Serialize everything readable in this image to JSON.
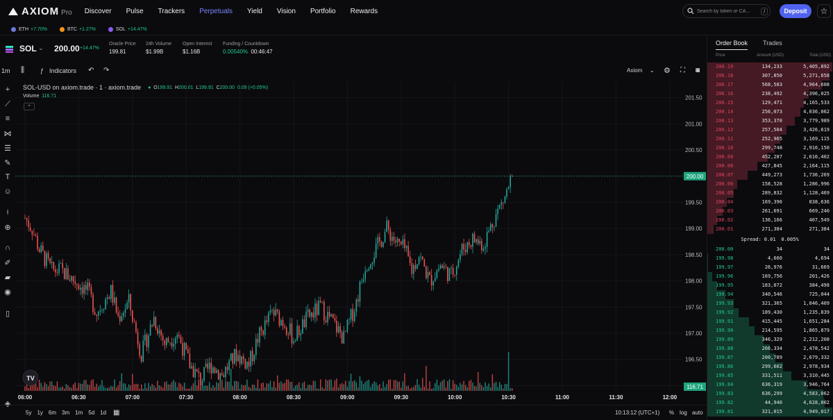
{
  "header": {
    "logo_text": "AXIOM",
    "logo_sub": "Pro",
    "nav": [
      "Discover",
      "Pulse",
      "Trackers",
      "Perpetuals",
      "Yield",
      "Vision",
      "Portfolio",
      "Rewards"
    ],
    "active_nav": "Perpetuals",
    "search_placeholder": "Search by token or CA...",
    "search_shortcut": "/",
    "deposit_label": "Deposit",
    "accent": "#5063f0"
  },
  "ticker": [
    {
      "symbol": "ETH",
      "change": "+7.70%",
      "color": "#6b7bd9"
    },
    {
      "symbol": "BTC",
      "change": "+1.27%",
      "color": "#f7931a"
    },
    {
      "symbol": "SOL",
      "change": "+14.47%",
      "color": "#8c5cf0"
    }
  ],
  "market": {
    "pair": "SOL",
    "price": "200.00",
    "change": "+14.47%",
    "stats": [
      {
        "label": "Oracle Price",
        "value": "199.81"
      },
      {
        "label": "24h Volume",
        "value": "$1.99B"
      },
      {
        "label": "Open Interest",
        "value": "$1.16B"
      },
      {
        "label": "Funding / Countdown",
        "value": "0.00540%",
        "value2": "00:46:47"
      }
    ]
  },
  "chart_toolbar": {
    "interval": "1m",
    "indicators_label": "Indicators",
    "source_label": "Axiom"
  },
  "chart_legend": {
    "title": "SOL-USD on axiom.trade · 1 · axiom.trade",
    "o_label": "O",
    "o": "199.91",
    "h_label": "H",
    "h": "200.01",
    "l_label": "L",
    "l": "199.91",
    "c_label": "C",
    "c": "200.00",
    "chg": "0.09 (+0.05%)",
    "volume_label": "Volume",
    "volume_value": "116.71"
  },
  "chart_data": {
    "type": "candlestick",
    "x_ticks": [
      "06:00",
      "06:30",
      "07:00",
      "07:30",
      "08:00",
      "08:30",
      "09:00",
      "09:30",
      "10:00",
      "10:30",
      "11:00",
      "11:30",
      "12:00"
    ],
    "y_ticks": [
      "201.50",
      "201.00",
      "200.50",
      "200.00",
      "199.50",
      "199.00",
      "198.50",
      "198.00",
      "197.50",
      "197.00",
      "196.50",
      "196.00"
    ],
    "y_range": [
      195.9,
      201.8
    ],
    "current_price": 200.0,
    "current_price_label": "200.00",
    "current_volume_label": "116.71",
    "close_path_times_min": [
      0,
      4,
      8,
      15,
      20,
      28,
      35,
      40,
      48,
      52,
      58,
      65,
      72,
      78,
      85,
      92,
      98,
      104,
      110,
      118,
      125,
      130,
      138,
      145,
      150,
      158,
      165,
      172,
      178,
      185,
      190,
      196,
      202,
      208,
      212,
      216,
      220,
      226,
      232,
      238,
      244,
      250,
      256,
      262,
      268,
      272
    ],
    "close_path_values": [
      199.2,
      199.0,
      198.6,
      198.2,
      198.2,
      198.0,
      197.8,
      197.4,
      197.8,
      197.3,
      197.6,
      196.6,
      197.3,
      196.8,
      197.0,
      196.4,
      196.1,
      196.4,
      196.2,
      196.6,
      196.4,
      196.9,
      197.4,
      197.2,
      196.9,
      197.3,
      197.5,
      197.2,
      196.9,
      197.6,
      198.3,
      198.6,
      199.0,
      198.7,
      198.6,
      198.2,
      198.5,
      198.0,
      198.3,
      198.1,
      198.6,
      198.8,
      198.7,
      199.2,
      199.6,
      200.0
    ],
    "colors": {
      "up": "#26a69a",
      "down": "#ef5350"
    }
  },
  "bottom_bar": {
    "ranges": [
      "5y",
      "1y",
      "6m",
      "3m",
      "1m",
      "5d",
      "1d"
    ],
    "time": "10:13:12 (UTC+1)",
    "pct": "%",
    "log": "log",
    "auto": "auto"
  },
  "orderbook": {
    "tabs": [
      "Order Book",
      "Trades"
    ],
    "active_tab": "Order Book",
    "columns": [
      "Price",
      "Amount (USD)",
      "Total (USD)"
    ],
    "asks": [
      {
        "price": "200.19",
        "amount": "134,233",
        "total": "5,405,892",
        "depth": 1.0
      },
      {
        "price": "200.18",
        "amount": "307,850",
        "total": "5,271,658",
        "depth": 0.975
      },
      {
        "price": "200.17",
        "amount": "568,583",
        "total": "4,964,608",
        "depth": 0.918
      },
      {
        "price": "200.16",
        "amount": "238,492",
        "total": "4,396,025",
        "depth": 0.813
      },
      {
        "price": "200.15",
        "amount": "129,471",
        "total": "4,165,533",
        "depth": 0.771
      },
      {
        "price": "200.14",
        "amount": "256,073",
        "total": "4,036,062",
        "depth": 0.747
      },
      {
        "price": "200.13",
        "amount": "353,370",
        "total": "3,779,989",
        "depth": 0.699
      },
      {
        "price": "200.12",
        "amount": "257,504",
        "total": "3,426,619",
        "depth": 0.634
      },
      {
        "price": "200.11",
        "amount": "252,965",
        "total": "3,169,115",
        "depth": 0.586
      },
      {
        "price": "200.10",
        "amount": "299,748",
        "total": "2,916,150",
        "depth": 0.539
      },
      {
        "price": "200.09",
        "amount": "452,287",
        "total": "2,616,402",
        "depth": 0.484
      },
      {
        "price": "200.08",
        "amount": "427,845",
        "total": "2,164,115",
        "depth": 0.4
      },
      {
        "price": "200.07",
        "amount": "449,273",
        "total": "1,736,269",
        "depth": 0.321
      },
      {
        "price": "200.06",
        "amount": "158,528",
        "total": "1,286,996",
        "depth": 0.238
      },
      {
        "price": "200.05",
        "amount": "289,832",
        "total": "1,128,469",
        "depth": 0.209
      },
      {
        "price": "200.04",
        "amount": "169,396",
        "total": "838,636",
        "depth": 0.155
      },
      {
        "price": "200.03",
        "amount": "261,691",
        "total": "669,240",
        "depth": 0.124
      },
      {
        "price": "200.02",
        "amount": "136,166",
        "total": "407,549",
        "depth": 0.075
      },
      {
        "price": "200.01",
        "amount": "271,384",
        "total": "271,384",
        "depth": 0.05
      }
    ],
    "spread_label": "Spread:",
    "spread_value": "0.01",
    "spread_pct": "0.005%",
    "bids": [
      {
        "price": "200.00",
        "amount": "34",
        "total": "34",
        "depth": 0.0
      },
      {
        "price": "199.98",
        "amount": "4,660",
        "total": "4,694",
        "depth": 0.001
      },
      {
        "price": "199.97",
        "amount": "26,976",
        "total": "31,669",
        "depth": 0.006
      },
      {
        "price": "199.96",
        "amount": "169,756",
        "total": "201,426",
        "depth": 0.04
      },
      {
        "price": "199.95",
        "amount": "183,072",
        "total": "384,498",
        "depth": 0.078
      },
      {
        "price": "199.94",
        "amount": "340,546",
        "total": "725,044",
        "depth": 0.147
      },
      {
        "price": "199.93",
        "amount": "321,365",
        "total": "1,046,409",
        "depth": 0.212
      },
      {
        "price": "199.92",
        "amount": "189,430",
        "total": "1,235,839",
        "depth": 0.25
      },
      {
        "price": "199.91",
        "amount": "415,445",
        "total": "1,651,284",
        "depth": 0.334
      },
      {
        "price": "199.90",
        "amount": "214,595",
        "total": "1,865,879",
        "depth": 0.378
      },
      {
        "price": "199.89",
        "amount": "346,329",
        "total": "2,212,208",
        "depth": 0.448
      },
      {
        "price": "199.88",
        "amount": "266,334",
        "total": "2,478,542",
        "depth": 0.502
      },
      {
        "price": "199.87",
        "amount": "200,789",
        "total": "2,679,332",
        "depth": 0.542
      },
      {
        "price": "199.86",
        "amount": "299,602",
        "total": "2,978,934",
        "depth": 0.603
      },
      {
        "price": "199.85",
        "amount": "331,511",
        "total": "3,310,445",
        "depth": 0.67
      },
      {
        "price": "199.84",
        "amount": "636,319",
        "total": "3,946,764",
        "depth": 0.799
      },
      {
        "price": "199.83",
        "amount": "636,299",
        "total": "4,583,062",
        "depth": 0.928
      },
      {
        "price": "199.82",
        "amount": "44,940",
        "total": "4,628,002",
        "depth": 0.937
      },
      {
        "price": "199.81",
        "amount": "321,015",
        "total": "4,949,017",
        "depth": 1.0
      }
    ],
    "ask_color": "#e0445c",
    "bid_color": "#22c98c"
  }
}
